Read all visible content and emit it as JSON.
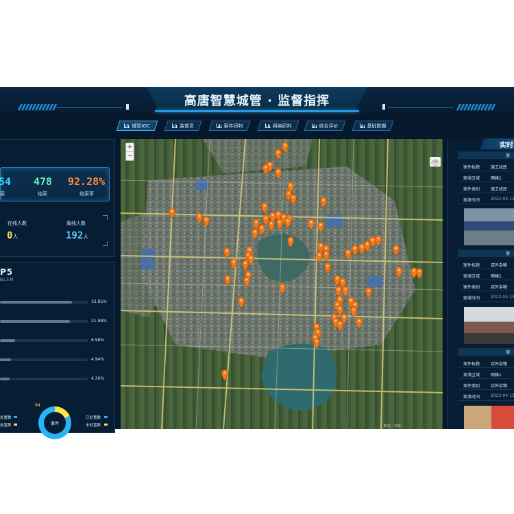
{
  "header": {
    "title": "高唐智慧城管 · 监督指挥"
  },
  "nav": {
    "tabs": [
      {
        "label": "城管IOC",
        "active": true
      },
      {
        "label": "监督员",
        "active": false
      },
      {
        "label": "案件研判",
        "active": false
      },
      {
        "label": "网格研判",
        "active": false
      },
      {
        "label": "综合评价",
        "active": false
      },
      {
        "label": "基础数据",
        "active": false
      }
    ]
  },
  "stats": {
    "first_value": "54",
    "first_caption": "案",
    "closed_value": "478",
    "closed_caption": "结案",
    "rate_value": "92.28%",
    "rate_caption": "结案率",
    "online_label": "在线人数",
    "online_value": "0",
    "offline_label": "离线人数",
    "offline_value": "192",
    "unit": "人"
  },
  "top5": {
    "title": "P5",
    "subtitle": "BLEM",
    "rows": [
      {
        "value": "32.85%",
        "percent": 32.85
      },
      {
        "value": "31.98%",
        "percent": 31.98
      },
      {
        "value": "6.98%",
        "percent": 6.98
      },
      {
        "value": "4.94%",
        "percent": 4.94
      },
      {
        "value": "4.36%",
        "percent": 4.36
      }
    ]
  },
  "events": {
    "center_label": "事件",
    "top_value": "94",
    "left_legend_1": "处置数",
    "left_legend_2": "处置数",
    "legend_handled": "已处置数",
    "legend_unhandled": "未处置数",
    "handled_fraction": 0.82,
    "colors": {
      "handled": "#27b5f5",
      "unhandled": "#ffe14a"
    }
  },
  "map": {
    "zoom_in": "+",
    "zoom_out": "−",
    "credit": "数说 · 专题"
  },
  "realtime": {
    "title": "实时",
    "cards": [
      {
        "head": "案",
        "rows": [
          {
            "key": "案件标题",
            "val": "施工扰民"
          },
          {
            "key": "案发区域",
            "val": "网格1"
          },
          {
            "key": "案件类别",
            "val": "施工扰民"
          },
          {
            "key": "案发时间",
            "val": "2022-04-13"
          }
        ]
      },
      {
        "head": "案",
        "rows": [
          {
            "key": "案件标题",
            "val": "店外杂物"
          },
          {
            "key": "案发区域",
            "val": "网格1"
          },
          {
            "key": "案件类别",
            "val": "店外杂物"
          },
          {
            "key": "案发时间",
            "val": "2022-04-13"
          }
        ]
      },
      {
        "head": "案",
        "rows": [
          {
            "key": "案件标题",
            "val": "店外杂物"
          },
          {
            "key": "案发区域",
            "val": "网格1"
          },
          {
            "key": "案件类别",
            "val": "店外杂物"
          },
          {
            "key": "案发时间",
            "val": "2022-04-13"
          }
        ]
      }
    ]
  }
}
